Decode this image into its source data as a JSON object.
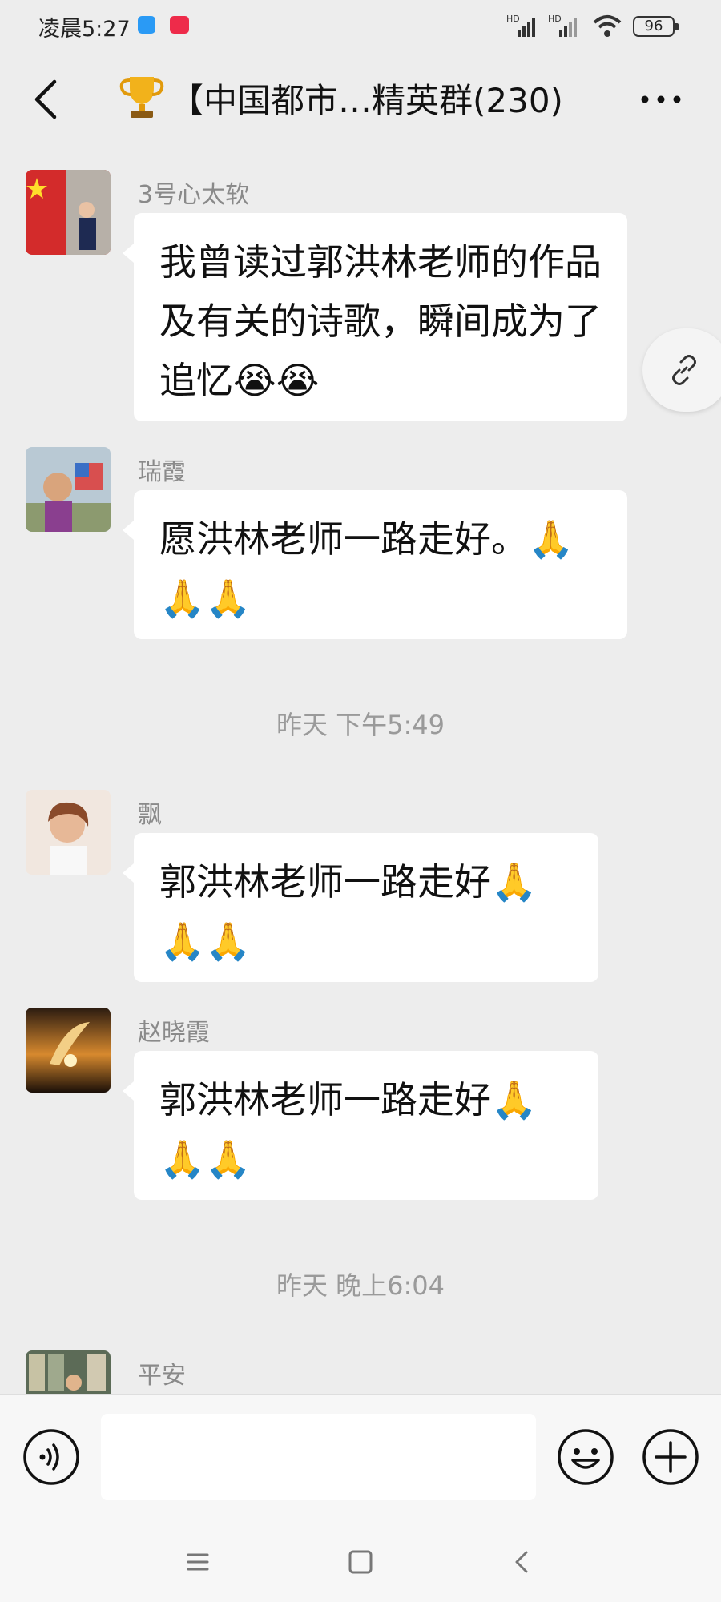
{
  "status_bar": {
    "time": "凌晨5:27",
    "signal1": "HD",
    "signal2": "HD",
    "battery": "96"
  },
  "header": {
    "title": "【中国都市…精英群(230)",
    "trophy_icon": "trophy-icon",
    "back_icon": "chevron-left-icon",
    "more_icon": "ellipsis-icon"
  },
  "messages": [
    {
      "sender": "3号心太软",
      "text": "我曾读过郭洪林老师的作品及有关的诗歌，瞬间成为了追忆😭😭"
    },
    {
      "sender": "瑞霞",
      "text": "愿洪林老师一路走好。🙏🙏🙏"
    },
    {
      "sender": "飘",
      "text": "郭洪林老师一路走好🙏🙏🙏"
    },
    {
      "sender": "赵晓霞",
      "text": "郭洪林老师一路走好🙏🙏🙏"
    },
    {
      "sender": "平安",
      "text": ""
    }
  ],
  "timestamps": [
    "昨天 下午5:49",
    "昨天 晚上6:04"
  ],
  "input": {
    "placeholder": "",
    "value": ""
  },
  "icons": {
    "voice": "voice-icon",
    "emoji": "smile-icon",
    "plus": "plus-icon",
    "link": "link-icon"
  },
  "colors": {
    "background": "#ededed",
    "bubble": "#ffffff",
    "muted_text": "#8a8a8a"
  }
}
